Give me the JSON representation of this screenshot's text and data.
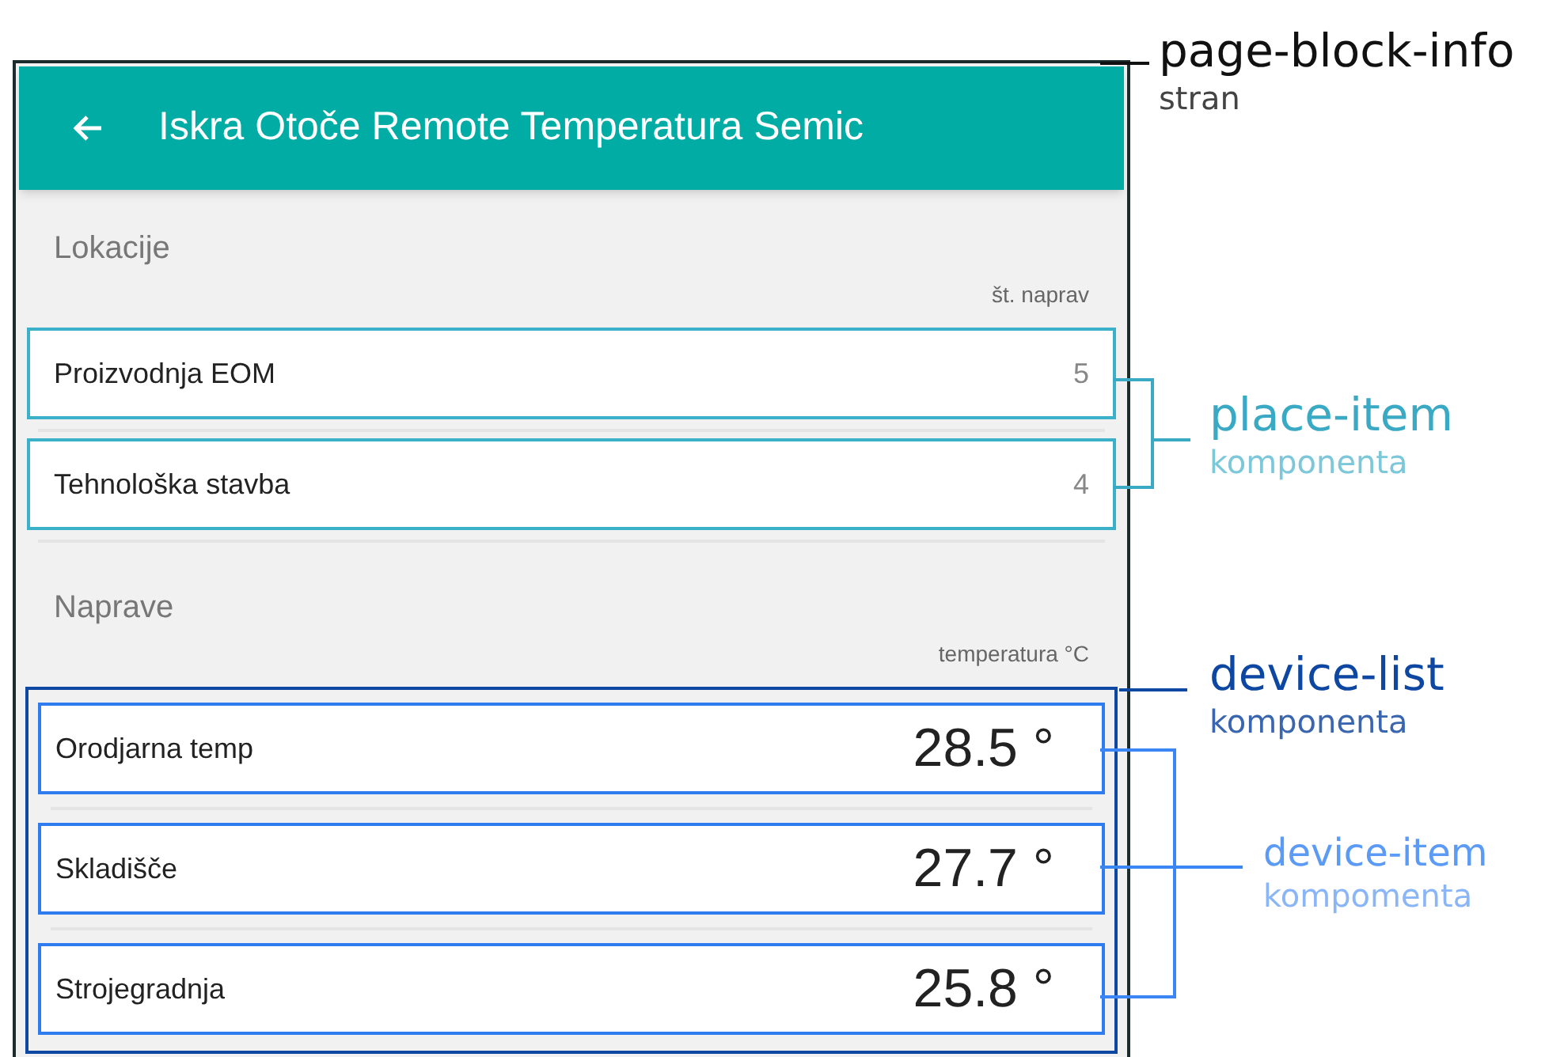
{
  "screen": {
    "title": "Iskra Otoče Remote Temperatura Semic",
    "sections": [
      {
        "kind": "places",
        "heading": "Lokacije",
        "column_label": "št. naprav",
        "items": [
          {
            "name": "Proizvodnja EOM",
            "value": "5"
          },
          {
            "name": "Tehnološka stavba",
            "value": "4"
          }
        ]
      },
      {
        "kind": "devices",
        "heading": "Naprave",
        "column_label": "temperatura °C",
        "items": [
          {
            "name": "Orodjarna temp",
            "value": "28.5 °"
          },
          {
            "name": "Skladišče",
            "value": "27.7 °"
          },
          {
            "name": "Strojegradnja",
            "value": "25.8 °"
          }
        ]
      }
    ]
  },
  "annotations": [
    {
      "kind": "page",
      "title": "page-block-info",
      "subtitle": "stran"
    },
    {
      "kind": "place",
      "title": "place-item",
      "subtitle": "komponenta"
    },
    {
      "kind": "list",
      "title": "device-list",
      "subtitle": "komponenta"
    },
    {
      "kind": "device",
      "title": "device-item",
      "subtitle": "kompomenta"
    }
  ]
}
